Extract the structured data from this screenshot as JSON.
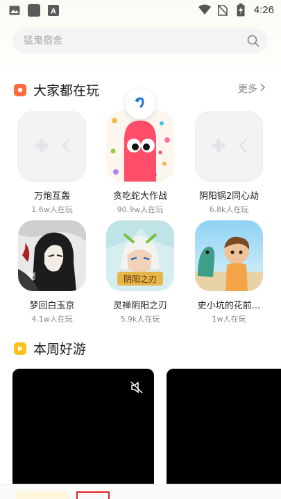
{
  "status_bar": {
    "time": "4:26",
    "left_icons": [
      "image-icon",
      "app-square-icon",
      "keyboard-a-icon"
    ],
    "right_icons": [
      "wifi-icon",
      "no-sim-icon",
      "battery-charging-icon"
    ]
  },
  "search": {
    "placeholder": "猛鬼宿舍"
  },
  "popular": {
    "title": "大家都在玩",
    "more_label": "更多",
    "games": [
      {
        "name": "万炮互轰",
        "players": "1.6w人在玩"
      },
      {
        "name": "贪吃蛇大作战",
        "players": "90.9w人在玩"
      },
      {
        "name": "阴阳锅2同心劫",
        "players": "6.8k人在玩"
      },
      {
        "name": "梦回白玉京",
        "players": "4.1w人在玩"
      },
      {
        "name": "灵禅阴阳之刃",
        "players": "5.9k人在玩"
      },
      {
        "name": "史小坑的花前...",
        "players": "1w人在玩"
      }
    ]
  },
  "weekly": {
    "title": "本周好游"
  },
  "colors": {
    "accent_orange": "#ff6a3d",
    "accent_yellow": "#ffc21a",
    "video_bg": "#000000"
  }
}
